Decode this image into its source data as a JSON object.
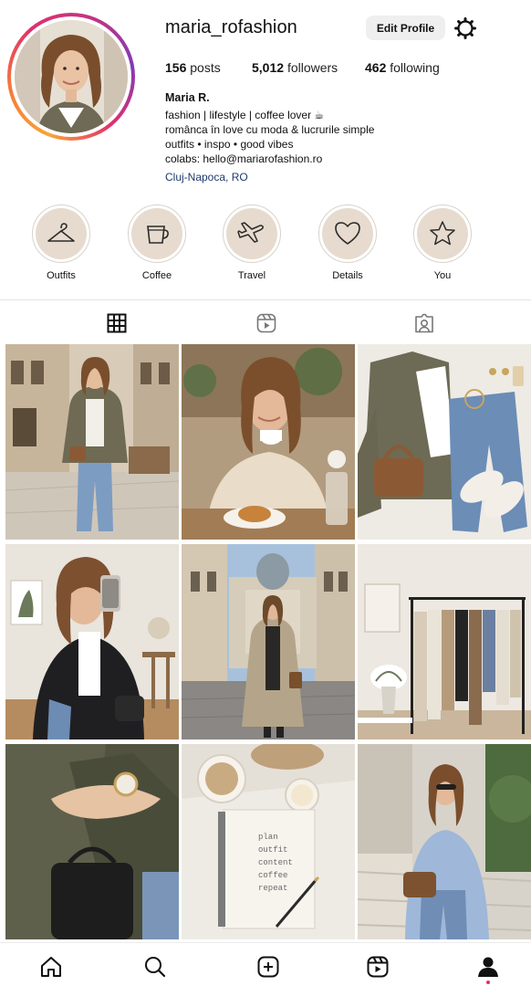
{
  "profile": {
    "username": "maria_rofashion",
    "edit_label": "Edit Profile",
    "posts_count": "156",
    "posts_label": "posts",
    "followers_count": "5,012",
    "followers_label": "followers",
    "following_count": "462",
    "following_label": "following",
    "display_name": "Maria R.",
    "bio_lines": [
      "fashion | lifestyle | coffee lover ☕",
      "românca în love cu moda & lucrurile simple",
      "outfits • inspo • good vibes",
      "colabs: hello@mariarofashion.ro"
    ],
    "location": "Cluj-Napoca, RO"
  },
  "highlights": [
    {
      "label": "Outfits",
      "icon": "hanger-icon"
    },
    {
      "label": "Coffee",
      "icon": "coffee-cup-icon"
    },
    {
      "label": "Travel",
      "icon": "airplane-icon"
    },
    {
      "label": "Details",
      "icon": "heart-icon"
    },
    {
      "label": "You",
      "icon": "star-icon"
    }
  ],
  "tabs": [
    {
      "name": "posts-grid",
      "icon": "grid-icon",
      "active": true
    },
    {
      "name": "reels",
      "icon": "reels-icon",
      "active": false
    },
    {
      "name": "tagged",
      "icon": "tagged-icon",
      "active": false
    }
  ],
  "posts": [
    {
      "name": "post-street-outfit"
    },
    {
      "name": "post-cafe-coffee"
    },
    {
      "name": "post-flatlay-outfit"
    },
    {
      "name": "post-mirror-selfie"
    },
    {
      "name": "post-city-trench"
    },
    {
      "name": "post-wardrobe-rack"
    },
    {
      "name": "post-bag-watch-detail"
    },
    {
      "name": "post-notebook-candle"
    },
    {
      "name": "post-blue-shirt-steps"
    }
  ],
  "notebook_text": [
    "plan",
    "outfit",
    "content",
    "coffee",
    "repeat"
  ],
  "bottom_nav": [
    {
      "name": "home",
      "icon": "home-icon"
    },
    {
      "name": "search",
      "icon": "search-icon"
    },
    {
      "name": "create",
      "icon": "plus-square-icon"
    },
    {
      "name": "reels",
      "icon": "reels-icon"
    },
    {
      "name": "profile",
      "icon": "profile-icon"
    }
  ],
  "colors": {
    "story_ring": [
      "#f9a43a",
      "#e1306c",
      "#833ab4"
    ],
    "location_link": "#1d3a6e",
    "highlight_fill": "#e6dbce",
    "button_bg": "#efefef"
  }
}
